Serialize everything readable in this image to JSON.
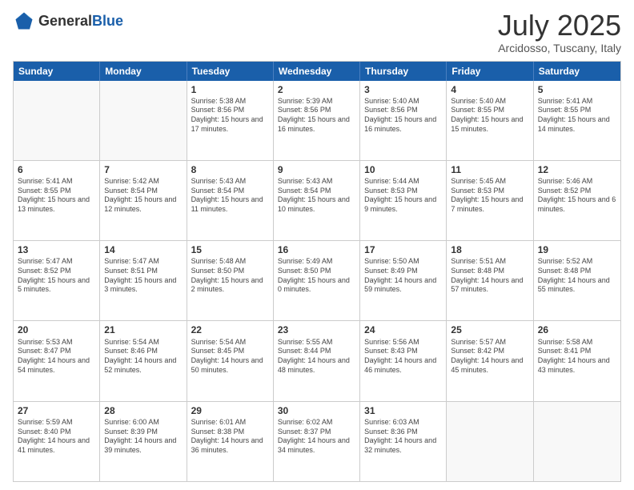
{
  "logo": {
    "general": "General",
    "blue": "Blue"
  },
  "title": "July 2025",
  "subtitle": "Arcidosso, Tuscany, Italy",
  "days": [
    "Sunday",
    "Monday",
    "Tuesday",
    "Wednesday",
    "Thursday",
    "Friday",
    "Saturday"
  ],
  "weeks": [
    [
      {
        "day": "",
        "empty": true
      },
      {
        "day": "",
        "empty": true
      },
      {
        "day": "1",
        "sunrise": "Sunrise: 5:38 AM",
        "sunset": "Sunset: 8:56 PM",
        "daylight": "Daylight: 15 hours and 17 minutes."
      },
      {
        "day": "2",
        "sunrise": "Sunrise: 5:39 AM",
        "sunset": "Sunset: 8:56 PM",
        "daylight": "Daylight: 15 hours and 16 minutes."
      },
      {
        "day": "3",
        "sunrise": "Sunrise: 5:40 AM",
        "sunset": "Sunset: 8:56 PM",
        "daylight": "Daylight: 15 hours and 16 minutes."
      },
      {
        "day": "4",
        "sunrise": "Sunrise: 5:40 AM",
        "sunset": "Sunset: 8:55 PM",
        "daylight": "Daylight: 15 hours and 15 minutes."
      },
      {
        "day": "5",
        "sunrise": "Sunrise: 5:41 AM",
        "sunset": "Sunset: 8:55 PM",
        "daylight": "Daylight: 15 hours and 14 minutes."
      }
    ],
    [
      {
        "day": "6",
        "sunrise": "Sunrise: 5:41 AM",
        "sunset": "Sunset: 8:55 PM",
        "daylight": "Daylight: 15 hours and 13 minutes."
      },
      {
        "day": "7",
        "sunrise": "Sunrise: 5:42 AM",
        "sunset": "Sunset: 8:54 PM",
        "daylight": "Daylight: 15 hours and 12 minutes."
      },
      {
        "day": "8",
        "sunrise": "Sunrise: 5:43 AM",
        "sunset": "Sunset: 8:54 PM",
        "daylight": "Daylight: 15 hours and 11 minutes."
      },
      {
        "day": "9",
        "sunrise": "Sunrise: 5:43 AM",
        "sunset": "Sunset: 8:54 PM",
        "daylight": "Daylight: 15 hours and 10 minutes."
      },
      {
        "day": "10",
        "sunrise": "Sunrise: 5:44 AM",
        "sunset": "Sunset: 8:53 PM",
        "daylight": "Daylight: 15 hours and 9 minutes."
      },
      {
        "day": "11",
        "sunrise": "Sunrise: 5:45 AM",
        "sunset": "Sunset: 8:53 PM",
        "daylight": "Daylight: 15 hours and 7 minutes."
      },
      {
        "day": "12",
        "sunrise": "Sunrise: 5:46 AM",
        "sunset": "Sunset: 8:52 PM",
        "daylight": "Daylight: 15 hours and 6 minutes."
      }
    ],
    [
      {
        "day": "13",
        "sunrise": "Sunrise: 5:47 AM",
        "sunset": "Sunset: 8:52 PM",
        "daylight": "Daylight: 15 hours and 5 minutes."
      },
      {
        "day": "14",
        "sunrise": "Sunrise: 5:47 AM",
        "sunset": "Sunset: 8:51 PM",
        "daylight": "Daylight: 15 hours and 3 minutes."
      },
      {
        "day": "15",
        "sunrise": "Sunrise: 5:48 AM",
        "sunset": "Sunset: 8:50 PM",
        "daylight": "Daylight: 15 hours and 2 minutes."
      },
      {
        "day": "16",
        "sunrise": "Sunrise: 5:49 AM",
        "sunset": "Sunset: 8:50 PM",
        "daylight": "Daylight: 15 hours and 0 minutes."
      },
      {
        "day": "17",
        "sunrise": "Sunrise: 5:50 AM",
        "sunset": "Sunset: 8:49 PM",
        "daylight": "Daylight: 14 hours and 59 minutes."
      },
      {
        "day": "18",
        "sunrise": "Sunrise: 5:51 AM",
        "sunset": "Sunset: 8:48 PM",
        "daylight": "Daylight: 14 hours and 57 minutes."
      },
      {
        "day": "19",
        "sunrise": "Sunrise: 5:52 AM",
        "sunset": "Sunset: 8:48 PM",
        "daylight": "Daylight: 14 hours and 55 minutes."
      }
    ],
    [
      {
        "day": "20",
        "sunrise": "Sunrise: 5:53 AM",
        "sunset": "Sunset: 8:47 PM",
        "daylight": "Daylight: 14 hours and 54 minutes."
      },
      {
        "day": "21",
        "sunrise": "Sunrise: 5:54 AM",
        "sunset": "Sunset: 8:46 PM",
        "daylight": "Daylight: 14 hours and 52 minutes."
      },
      {
        "day": "22",
        "sunrise": "Sunrise: 5:54 AM",
        "sunset": "Sunset: 8:45 PM",
        "daylight": "Daylight: 14 hours and 50 minutes."
      },
      {
        "day": "23",
        "sunrise": "Sunrise: 5:55 AM",
        "sunset": "Sunset: 8:44 PM",
        "daylight": "Daylight: 14 hours and 48 minutes."
      },
      {
        "day": "24",
        "sunrise": "Sunrise: 5:56 AM",
        "sunset": "Sunset: 8:43 PM",
        "daylight": "Daylight: 14 hours and 46 minutes."
      },
      {
        "day": "25",
        "sunrise": "Sunrise: 5:57 AM",
        "sunset": "Sunset: 8:42 PM",
        "daylight": "Daylight: 14 hours and 45 minutes."
      },
      {
        "day": "26",
        "sunrise": "Sunrise: 5:58 AM",
        "sunset": "Sunset: 8:41 PM",
        "daylight": "Daylight: 14 hours and 43 minutes."
      }
    ],
    [
      {
        "day": "27",
        "sunrise": "Sunrise: 5:59 AM",
        "sunset": "Sunset: 8:40 PM",
        "daylight": "Daylight: 14 hours and 41 minutes."
      },
      {
        "day": "28",
        "sunrise": "Sunrise: 6:00 AM",
        "sunset": "Sunset: 8:39 PM",
        "daylight": "Daylight: 14 hours and 39 minutes."
      },
      {
        "day": "29",
        "sunrise": "Sunrise: 6:01 AM",
        "sunset": "Sunset: 8:38 PM",
        "daylight": "Daylight: 14 hours and 36 minutes."
      },
      {
        "day": "30",
        "sunrise": "Sunrise: 6:02 AM",
        "sunset": "Sunset: 8:37 PM",
        "daylight": "Daylight: 14 hours and 34 minutes."
      },
      {
        "day": "31",
        "sunrise": "Sunrise: 6:03 AM",
        "sunset": "Sunset: 8:36 PM",
        "daylight": "Daylight: 14 hours and 32 minutes."
      },
      {
        "day": "",
        "empty": true
      },
      {
        "day": "",
        "empty": true
      }
    ]
  ]
}
